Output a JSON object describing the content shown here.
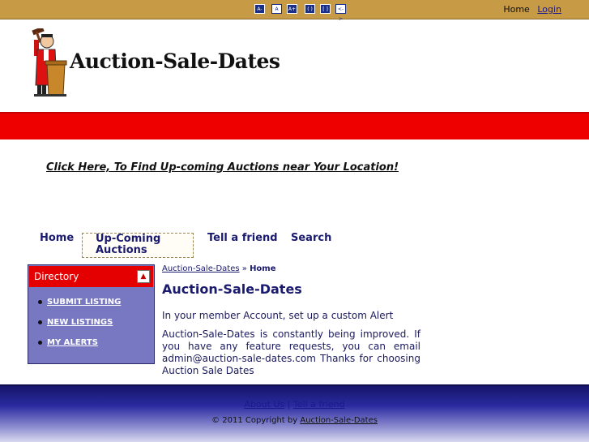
{
  "topbar": {
    "tools": [
      "A-",
      "A",
      "A+",
      "( )",
      "[ ]",
      "<->"
    ],
    "home": "Home",
    "login": "Login"
  },
  "header": {
    "logo_text": "Auction-Sale-Dates"
  },
  "promo": "Click Here, To Find Up-coming Auctions near Your Location!",
  "nav": {
    "home": "Home",
    "upcoming": "Up-Coming Auctions",
    "tell": "Tell a friend",
    "search": "Search"
  },
  "sidebar": {
    "title": "Directory",
    "items": [
      "SUBMIT LISTING",
      "NEW LISTINGS",
      "MY ALERTS"
    ]
  },
  "breadcrumb": {
    "link": "Auction-Sale-Dates",
    "sep": " » ",
    "current": "Home"
  },
  "content": {
    "title": "Auction-Sale-Dates",
    "para1": "In your member Account, set up a custom Alert",
    "para2": "Auction-Sale-Dates is constantly being improved. If you have any feature requests, you can email admin@auction-sale-dates.com Thanks for choosing Auction Sale Dates"
  },
  "footer": {
    "about": "About Us",
    "sep": " | ",
    "tell": "Tell a friend",
    "copy_prefix": "© 2011 Copyright by ",
    "copy_link": "Auction-Sale-Dates"
  },
  "colors": {
    "topbar": "#c79a45",
    "red_band": "#ee0000",
    "sidebar": "#7878c2",
    "navy_text": "#1a1a6e"
  }
}
